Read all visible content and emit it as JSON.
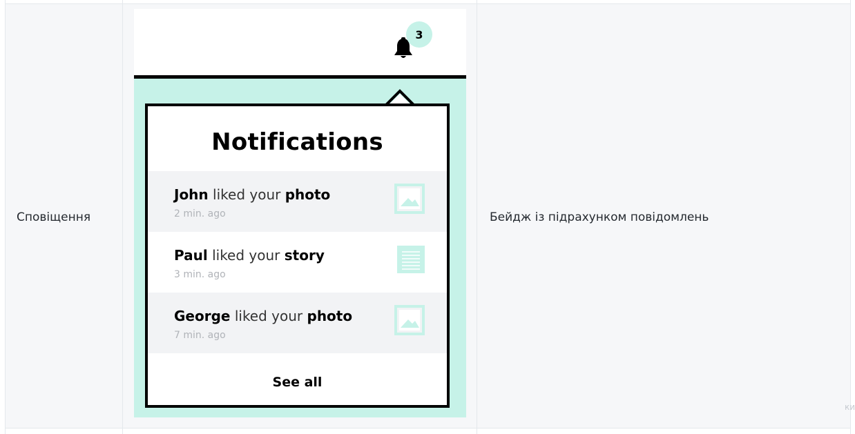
{
  "row": {
    "label": "Сповіщення",
    "description": "Бейдж із підрахунком повідомлень",
    "cut_off_text": "ки"
  },
  "preview": {
    "badge_count": "3",
    "panel_title": "Notifications",
    "notifications": [
      {
        "user": "John",
        "verb": "liked your",
        "object": "photo",
        "time": "2 min. ago",
        "thumb_icon": "image-icon"
      },
      {
        "user": "Paul",
        "verb": "liked your",
        "object": "story",
        "time": "3 min. ago",
        "thumb_icon": "document-icon"
      },
      {
        "user": "George",
        "verb": "liked your",
        "object": "photo",
        "time": "7 min. ago",
        "thumb_icon": "image-icon"
      }
    ],
    "see_all_label": "See all"
  },
  "colors": {
    "accent_mint": "#c6f2e8",
    "border_black": "#000000",
    "table_cell_bg": "#f6f7f9"
  }
}
